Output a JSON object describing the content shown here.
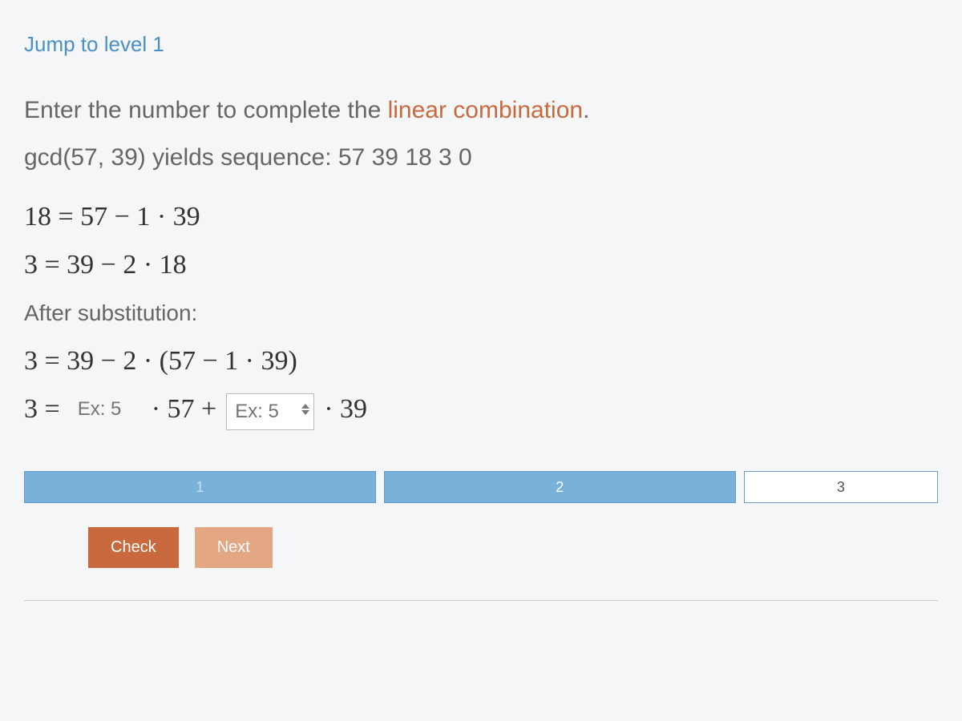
{
  "jump_link": "Jump to level 1",
  "instruction": {
    "prefix": "Enter the number to complete the ",
    "accent": "linear combination",
    "suffix": "."
  },
  "gcd_line": "gcd(57, 39) yields sequence: 57 39 18 3 0",
  "math": {
    "line1": "18 = 57 − 1 · 39",
    "line2": "3 = 39 − 2 · 18",
    "after_sub": "After substitution:",
    "line3": "3 = 39 − 2 · (57 − 1 · 39)",
    "line4_lhs": "3 =",
    "input1_placeholder": "Ex: 5",
    "mid1": "· 57 +",
    "input2_placeholder": "Ex: 5",
    "mid2": "· 39"
  },
  "progress": {
    "seg1": "1",
    "seg2": "2",
    "seg3": "3"
  },
  "buttons": {
    "check": "Check",
    "next": "Next"
  }
}
